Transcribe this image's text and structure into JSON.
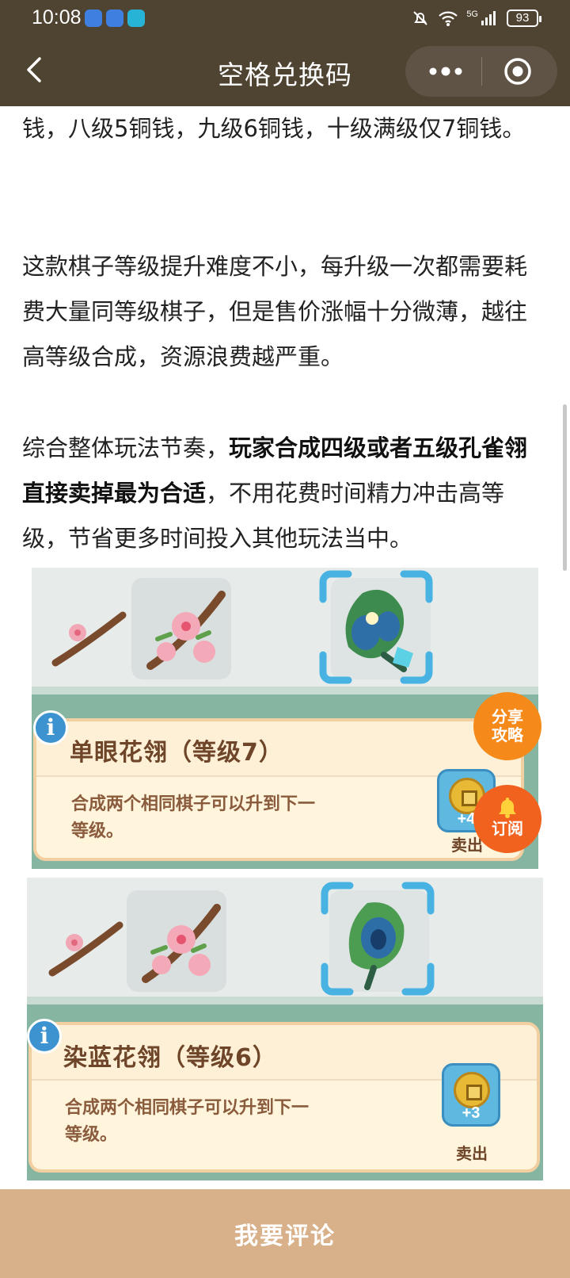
{
  "status_bar": {
    "time": "10:08",
    "signal_label": "5G",
    "battery": "93"
  },
  "nav": {
    "title": "空格兑换码"
  },
  "article": {
    "p1": "钱，八级5铜钱，九级6铜钱，十级满级仅7铜钱。",
    "p2": "这款棋子等级提升难度不小，每升级一次都需要耗费大量同等级棋子，但是售价涨幅十分微薄，越往高等级合成，资源浪费越严重。",
    "p3_pre": "综合整体玩法节奏，",
    "p3_bold": "玩家合成四级或者五级孔雀翎直接卖掉最为合适",
    "p3_post": "，不用花费时间精力冲击高等级，节省更多时间投入其他玩法当中。"
  },
  "screenshots": [
    {
      "item_name": "单眼花翎（等级7）",
      "description_line1": "合成两个相同棋子可以升到下一",
      "description_line2": "等级。",
      "coin_value": "+4",
      "sell_label": "卖出"
    },
    {
      "item_name": "染蓝花翎（等级6）",
      "description_line1": "合成两个相同棋子可以升到下一",
      "description_line2": "等级。",
      "coin_value": "+3",
      "sell_label": "卖出"
    }
  ],
  "floating": {
    "share_line1": "分享",
    "share_line2": "攻略",
    "subscribe": "订阅"
  },
  "bottom": {
    "comment": "我要评论"
  },
  "colors": {
    "header_bg": "#4f4331",
    "bottom_bar": "#d8b08a",
    "share_button": "#f58a1b",
    "subscribe_button": "#f0621e"
  }
}
